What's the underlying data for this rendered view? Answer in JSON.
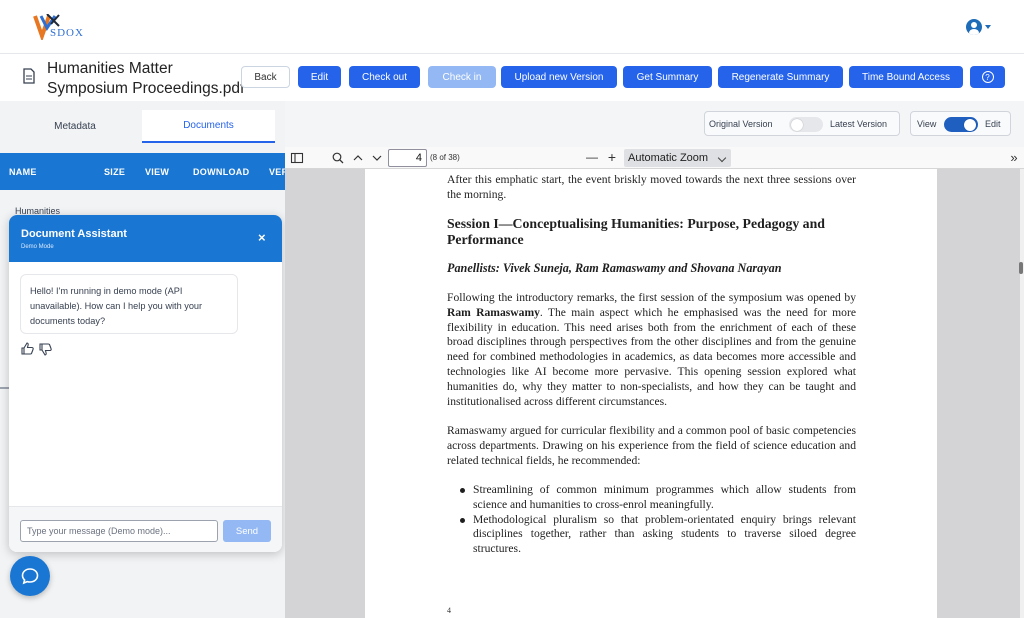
{
  "app": {
    "logo_text": "SDOX"
  },
  "file": {
    "title": "Humanities Matter Symposium Proceedings.pdf"
  },
  "buttons": {
    "back": "Back",
    "edit": "Edit",
    "check_out": "Check out",
    "check_in": "Check in",
    "upload": "Upload new Version",
    "summary": "Get Summary",
    "regenerate": "Regenerate Summary",
    "time_access": "Time Bound Access",
    "help": "?"
  },
  "left_tabs": [
    "Metadata",
    "Documents"
  ],
  "table_headers": [
    "NAME",
    "SIZE",
    "VIEW",
    "DOWNLOAD",
    "VER"
  ],
  "table_rows": [
    {
      "name": "Humanities"
    }
  ],
  "chat": {
    "title": "Document Assistant",
    "subtitle": "Demo Mode",
    "close": "×",
    "message": "Hello! I'm running in demo mode (API unavailable). How can I help you with your documents today?",
    "placeholder": "Type your message (Demo mode)...",
    "send": "Send"
  },
  "version_toggle": {
    "left": "Original Version",
    "right": "Latest Version",
    "on": false
  },
  "view_toggle": {
    "left": "View",
    "right": "Edit",
    "on": true
  },
  "pdf_toolbar": {
    "page": "4",
    "page_count": "(8 of 38)",
    "zoom": "Automatic Zoom",
    "minus": "—",
    "plus": "+",
    "more": "»"
  },
  "pdf": {
    "intro": "After this emphatic start, the event briskly moved towards the next three sessions over the morning.",
    "heading": "Session I—Conceptualising Humanities: Purpose, Pedagogy and Performance",
    "panellists": "Panellists: Vivek Suneja, Ram Ramaswamy and Shovana Narayan",
    "para1_a": "Following the introductory remarks, the first session of the symposium was opened by ",
    "para1_bold": "Ram Ramaswamy",
    "para1_b": ". The main aspect which he emphasised was the need for more flexibility in education. This need arises both from the enrichment of each of these broad disciplines through perspectives from the other disciplines and from the genuine need for combined methodologies in academics, as data becomes more accessible and technologies like AI become more pervasive. This opening session explored what humanities do, why they matter to non-specialists, and how they can be taught and institutionalised across different circumstances.",
    "para2": "Ramaswamy argued for curricular flexibility and a common pool of basic competencies across departments. Drawing on his experience from the field of science education and related technical fields, he recommended:",
    "bullets": [
      "Streamlining of common minimum programmes which allow students from science and humanities to cross-enrol meaningfully.",
      "Methodological pluralism so that problem-orientated enquiry brings relevant disciplines together, rather than asking students to traverse siloed degree structures."
    ],
    "page_number": "4"
  },
  "colors": {
    "primary": "#2563eb",
    "header_blue": "#1976d2",
    "disabled": "#93b8f3"
  }
}
